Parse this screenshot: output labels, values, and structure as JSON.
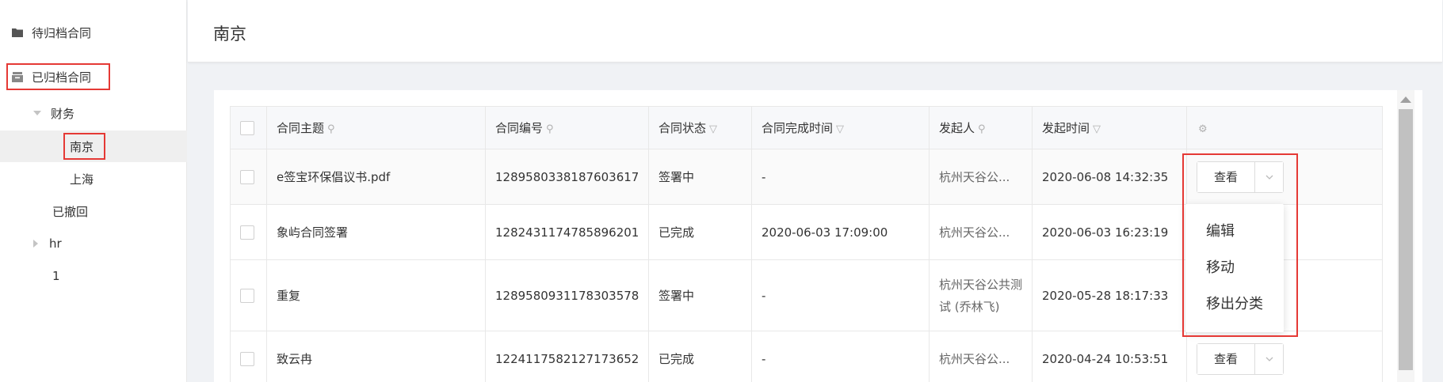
{
  "sidebar": {
    "items": [
      {
        "label": "待归档合同",
        "icon": "folder-icon"
      },
      {
        "label": "已归档合同",
        "icon": "archive-box-icon"
      },
      {
        "label": "财务"
      },
      {
        "label": "南京"
      },
      {
        "label": "上海"
      },
      {
        "label": "已撤回"
      },
      {
        "label": "hr"
      },
      {
        "label": "1"
      }
    ]
  },
  "header": {
    "title": "南京"
  },
  "table": {
    "columns": [
      {
        "label": "合同主题",
        "icon": "search-icon"
      },
      {
        "label": "合同编号",
        "icon": "search-icon"
      },
      {
        "label": "合同状态",
        "icon": "filter-icon"
      },
      {
        "label": "合同完成时间",
        "icon": "filter-icon"
      },
      {
        "label": "发起人",
        "icon": "search-icon"
      },
      {
        "label": "发起时间",
        "icon": "filter-icon"
      },
      {
        "label": "",
        "icon": "settings-icon"
      }
    ],
    "rows": [
      {
        "subject": "e签宝环保倡议书.pdf",
        "number": "1289580338187603617",
        "status": "签署中",
        "completed": "-",
        "initiator": "杭州天谷公...",
        "started": "2020-06-08 14:32:35"
      },
      {
        "subject": "象屿合同签署",
        "number": "1282431174785896201",
        "status": "已完成",
        "completed": "2020-06-03 17:09:00",
        "initiator": "杭州天谷公...",
        "started": "2020-06-03 16:23:19"
      },
      {
        "subject": "重复",
        "number": "1289580931178303578",
        "status": "签署中",
        "completed": "-",
        "initiator": "杭州天谷公共测试 (乔林飞)",
        "started": "2020-05-28 18:17:33"
      },
      {
        "subject": "致云冉",
        "number": "1224117582127173652",
        "status": "已完成",
        "completed": "-",
        "initiator": "杭州天谷公...",
        "started": "2020-04-24 10:53:51"
      }
    ],
    "view_label": "查看"
  },
  "dropdown": {
    "items": [
      "编辑",
      "移动",
      "移出分类"
    ]
  },
  "colors": {
    "highlight": "#e53935",
    "header_bg": "#f7f8fa",
    "active_bg": "#efefef"
  }
}
